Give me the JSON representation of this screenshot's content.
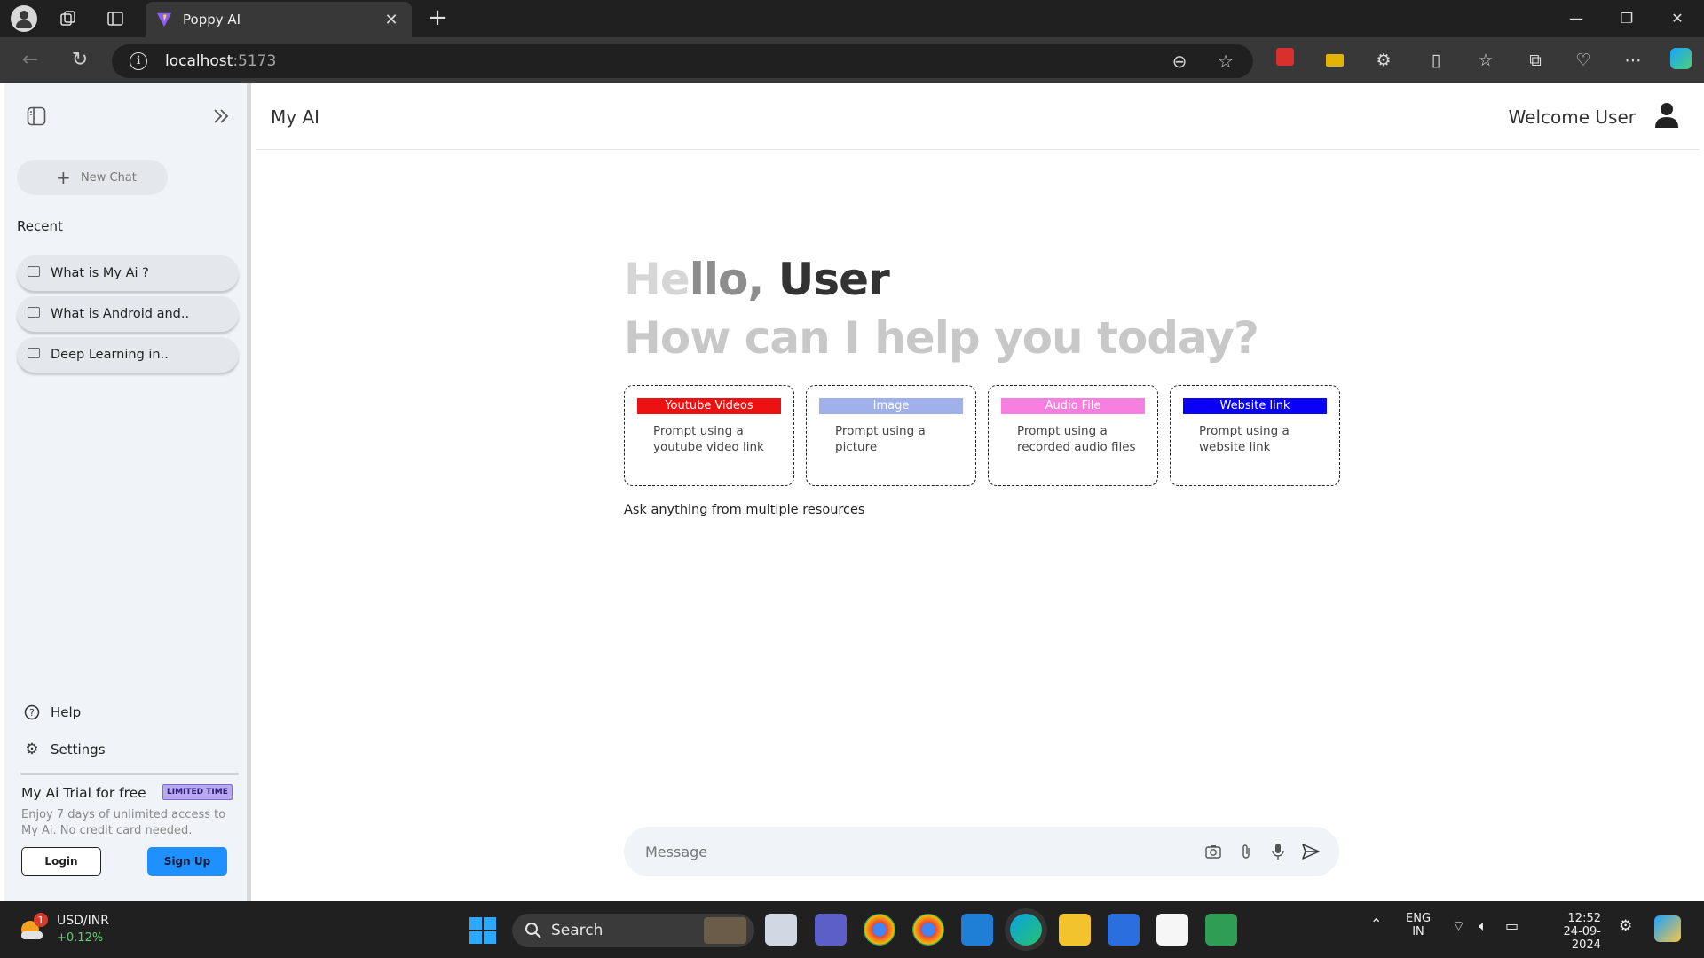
{
  "browser": {
    "tab_title": "Poppy AI",
    "url_host": "localhost",
    "url_port": ":5173"
  },
  "sidebar": {
    "new_chat_label": "New Chat",
    "recent_title": "Recent",
    "recent_items": [
      {
        "label": "What is My Ai ?"
      },
      {
        "label": "What is Android and.."
      },
      {
        "label": "Deep Learning in.."
      }
    ],
    "help_label": "Help",
    "settings_label": "Settings",
    "trial": {
      "title": "My Ai Trial for free",
      "badge": "LIMITED TIME",
      "description": "Enjoy 7 days of unlimited access to My Ai. No credit card needed.",
      "login_label": "Login",
      "signup_label": "Sign Up"
    }
  },
  "header": {
    "title": "My AI",
    "welcome": "Welcome User"
  },
  "greeting": {
    "hello_1": "He",
    "hello_2": "llo, ",
    "hello_3": "User",
    "subtitle": "How can I help you today?"
  },
  "cards": [
    {
      "label": "Youtube Videos",
      "desc": "Prompt using a youtube video link",
      "color": "#ee1111"
    },
    {
      "label": "Image",
      "desc": "Prompt using a picture",
      "color": "#9fb0ea"
    },
    {
      "label": "Audio File",
      "desc": "Prompt using a recorded audio files",
      "color": "#f77fe0"
    },
    {
      "label": "Website link",
      "desc": "Prompt using a website link",
      "color": "#0a00f5"
    }
  ],
  "ask_text": "Ask anything from multiple resources",
  "message": {
    "placeholder": "Message"
  },
  "taskbar": {
    "stock_name": "USD/INR",
    "stock_change": "+0.12%",
    "weather_badge": "1",
    "search_label": "Search",
    "lang_1": "ENG",
    "lang_2": "IN",
    "time": "12:52",
    "date": "24-09-2024"
  }
}
